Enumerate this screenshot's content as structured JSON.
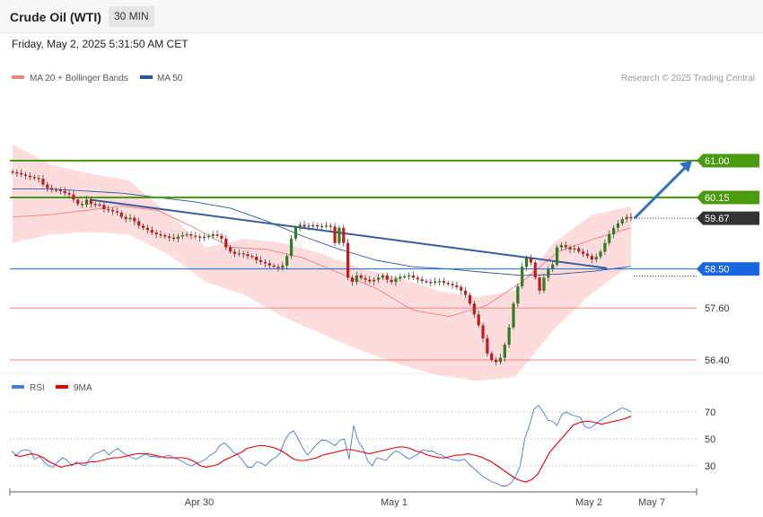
{
  "header": {
    "title": "Crude Oil (WTI)",
    "timeframe": "30 MIN",
    "datetime": "Friday, May 2, 2025 5:31:50 AM CET"
  },
  "legend": {
    "ma20_label": "MA 20 + Bollinger Bands",
    "ma50_label": "MA 50",
    "credit": "Research © 2025 Trading Central",
    "ma20_color": "#f08080",
    "ma50_color": "#2f5597"
  },
  "rsi_legend": {
    "rsi_label": "RSI",
    "ma9_label": "9MA",
    "rsi_color": "#4a78d6",
    "ma9_color": "#e00000"
  },
  "chart_data": [
    {
      "type": "candlestick",
      "y_range": [
        56.2,
        62.1
      ],
      "levels": [
        {
          "value": 61.0,
          "label": "61.00",
          "kind": "resistance",
          "color": "#4a9b0f"
        },
        {
          "value": 60.15,
          "label": "60.15",
          "kind": "resistance",
          "color": "#4a9b0f"
        },
        {
          "value": 59.67,
          "label": "59.67",
          "kind": "last",
          "color": "#333333"
        },
        {
          "value": 58.5,
          "label": "58.50",
          "kind": "pivot",
          "color": "#1a66e0"
        },
        {
          "value": 57.6,
          "label": "57.60",
          "kind": "support",
          "color": "#f08080"
        },
        {
          "value": 56.4,
          "label": "56.40",
          "kind": "support",
          "color": "#f08080"
        }
      ],
      "x_labels": [
        "Apr 30",
        "May 1",
        "May 2",
        "May 7"
      ],
      "close": [
        60.73,
        60.71,
        60.68,
        60.65,
        60.62,
        60.6,
        60.58,
        60.45,
        60.37,
        60.33,
        60.32,
        60.3,
        60.25,
        60.22,
        60.1,
        60.0,
        59.98,
        60.1,
        60.0,
        59.99,
        59.98,
        59.88,
        59.86,
        59.83,
        59.8,
        59.7,
        59.65,
        59.68,
        59.6,
        59.5,
        59.45,
        59.4,
        59.34,
        59.3,
        59.28,
        59.25,
        59.22,
        59.2,
        59.25,
        59.28,
        59.3,
        59.27,
        59.25,
        59.22,
        59.24,
        59.26,
        59.3,
        59.27,
        59.2,
        59.0,
        58.9,
        58.85,
        58.86,
        58.84,
        58.8,
        58.78,
        58.7,
        58.66,
        58.63,
        58.58,
        58.55,
        58.52,
        58.58,
        58.8,
        59.2,
        59.45,
        59.52,
        59.48,
        59.5,
        59.51,
        59.48,
        59.49,
        59.5,
        59.48,
        59.1,
        59.45,
        59.1,
        58.3,
        58.2,
        58.35,
        58.29,
        58.25,
        58.21,
        58.25,
        58.3,
        58.35,
        58.25,
        58.2,
        58.28,
        58.32,
        58.33,
        58.35,
        58.3,
        58.26,
        58.22,
        58.2,
        58.18,
        58.21,
        58.22,
        58.18,
        58.15,
        58.12,
        58.08,
        58.0,
        57.9,
        57.7,
        57.45,
        57.2,
        56.9,
        56.55,
        56.4,
        56.35,
        56.45,
        56.75,
        57.15,
        57.7,
        58.1,
        58.55,
        58.75,
        58.65,
        58.3,
        58.0,
        58.3,
        58.5,
        58.6,
        59.0,
        59.05,
        59.0,
        58.95,
        58.98,
        58.9,
        58.85,
        58.8,
        58.72,
        58.78,
        58.9,
        59.1,
        59.3,
        59.45,
        59.55,
        59.65,
        59.7,
        59.67
      ],
      "bollinger": {
        "upper": [
          61.38,
          60.9,
          60.7,
          60.55,
          59.8,
          59.0,
          59.2,
          59.1,
          58.85,
          58.52,
          58.3,
          58.0,
          57.85,
          58.0,
          59.1,
          59.75,
          59.95
        ],
        "lower": [
          59.1,
          59.3,
          59.35,
          59.3,
          58.85,
          58.2,
          57.9,
          57.4,
          57.0,
          56.62,
          56.3,
          56.05,
          55.92,
          56.0,
          57.1,
          57.95,
          58.6
        ]
      },
      "ma20": [
        59.7,
        59.75,
        59.85,
        59.95,
        59.85,
        59.45,
        59.0,
        58.95,
        58.75,
        58.4,
        58.05,
        57.55,
        57.4,
        57.65,
        58.2,
        58.9,
        59.2,
        59.45
      ],
      "ma50": [
        60.35,
        60.35,
        60.3,
        60.25,
        60.15,
        60.05,
        59.9,
        59.6,
        59.25,
        58.95,
        58.7,
        58.55,
        58.5,
        58.42,
        58.35,
        58.38,
        58.45,
        58.56
      ],
      "trendline": [
        {
          "from": 60.1,
          "to": 58.52
        }
      ],
      "forecast_target": 61.0
    },
    {
      "type": "line",
      "name": "RSI",
      "y_ticks": [
        70,
        50,
        30
      ],
      "series": [
        {
          "name": "RSI",
          "values": [
            41,
            38,
            41,
            42,
            41,
            35,
            37,
            33,
            30,
            29,
            33,
            36,
            34,
            30,
            33,
            31,
            30,
            36,
            39,
            40,
            42,
            38,
            41,
            43,
            40,
            38,
            36,
            35,
            37,
            39,
            37,
            37,
            36,
            37,
            38,
            36,
            35,
            33,
            31,
            30,
            32,
            33,
            35,
            38,
            40,
            45,
            47,
            44,
            40,
            38,
            34,
            29,
            29,
            33,
            32,
            30,
            34,
            36,
            39,
            48,
            54,
            56,
            50,
            43,
            38,
            42,
            46,
            49,
            49,
            47,
            45,
            49,
            50,
            35,
            60,
            48,
            43,
            34,
            30,
            36,
            35,
            34,
            38,
            41,
            40,
            37,
            35,
            37,
            39,
            42,
            41,
            41,
            39,
            38,
            36,
            35,
            34,
            34,
            35,
            31,
            28,
            25,
            22,
            20,
            18,
            17,
            15,
            15,
            17,
            22,
            30,
            50,
            60,
            72,
            75,
            70,
            64,
            63,
            60,
            68,
            70,
            68,
            67,
            66,
            59,
            58,
            60,
            63,
            65,
            67,
            69,
            71,
            73,
            72,
            70
          ]
        },
        {
          "name": "9MA",
          "values": [
            38,
            37,
            38,
            39,
            38,
            36,
            33,
            31,
            29,
            30,
            31,
            32,
            32,
            33,
            33,
            34,
            35,
            36,
            36,
            37,
            38,
            39,
            39,
            39,
            38,
            37,
            36,
            36,
            36,
            36,
            35,
            33,
            30,
            29,
            30,
            31,
            34,
            36,
            38,
            40,
            43,
            44,
            45,
            45,
            44,
            43,
            41,
            38,
            35,
            34,
            34,
            35,
            36,
            38,
            39,
            40,
            41,
            42,
            42,
            41,
            40,
            39,
            40,
            41,
            42,
            43,
            44,
            44,
            43,
            41,
            40,
            38,
            37,
            36,
            36,
            37,
            38,
            38,
            39,
            38,
            37,
            35,
            33,
            30,
            27,
            24,
            21,
            19,
            18,
            20,
            24,
            32,
            40,
            45,
            50,
            55,
            60,
            62,
            63,
            63,
            62,
            61,
            62,
            63,
            64,
            65,
            67
          ]
        }
      ]
    }
  ]
}
